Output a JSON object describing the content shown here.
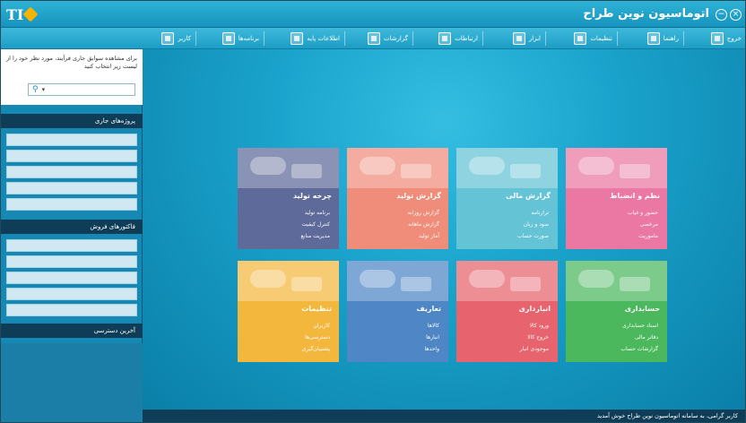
{
  "window": {
    "title": "اتوماسیون نوین طراح",
    "minimize_glyph": "−",
    "close_glyph": "×"
  },
  "toolbar": {
    "items": [
      "خروج",
      "راهنما",
      "تنظیمات",
      "ابزار",
      "ارتباطات",
      "گزارشات",
      "اطلاعات پایه",
      "برنامه‌ها",
      "کاربر"
    ]
  },
  "sidebar": {
    "intro_text": "برای مشاهده سوابق جاری فرآیند، مورد نظر خود را از لیست زیر انتخاب کنید",
    "select_value": "",
    "panel1_title": "پروژه‌های جاری",
    "panel2_title": "فاکتورهای فروش",
    "panel3_title": "آخرین دسترسی"
  },
  "tiles": [
    {
      "title": "چرخه تولید",
      "items": [
        "برنامه تولید",
        "کنترل کیفیت",
        "مدیریت منابع"
      ]
    },
    {
      "title": "گزارش تولید",
      "items": [
        "گزارش روزانه",
        "گزارش ماهانه",
        "آمار تولید"
      ]
    },
    {
      "title": "گزارش مالی",
      "items": [
        "ترازنامه",
        "سود و زیان",
        "صورت حساب"
      ]
    },
    {
      "title": "نظم و انضباط",
      "items": [
        "حضور و غیاب",
        "مرخصی",
        "ماموریت"
      ]
    },
    {
      "title": "تنظیمات",
      "items": [
        "کاربران",
        "دسترسی‌ها",
        "پشتیبان‌گیری"
      ]
    },
    {
      "title": "تعاریف",
      "items": [
        "کالاها",
        "انبارها",
        "واحدها"
      ]
    },
    {
      "title": "انبارداری",
      "items": [
        "ورود کالا",
        "خروج کالا",
        "موجودی انبار"
      ]
    },
    {
      "title": "حسابداری",
      "items": [
        "اسناد حسابداری",
        "دفاتر مالی",
        "گزارشات حساب"
      ]
    }
  ],
  "statusbar": {
    "text": "کاربر گرامی، به سامانه اتوماسیون نوین طراح خوش آمدید"
  },
  "colors": {
    "tile_colors": [
      "#5d6a9a",
      "#ef8d7a",
      "#64c3d5",
      "#ea78a2",
      "#f3b73d",
      "#4e86c6",
      "#e7636d",
      "#4cb85d"
    ]
  }
}
